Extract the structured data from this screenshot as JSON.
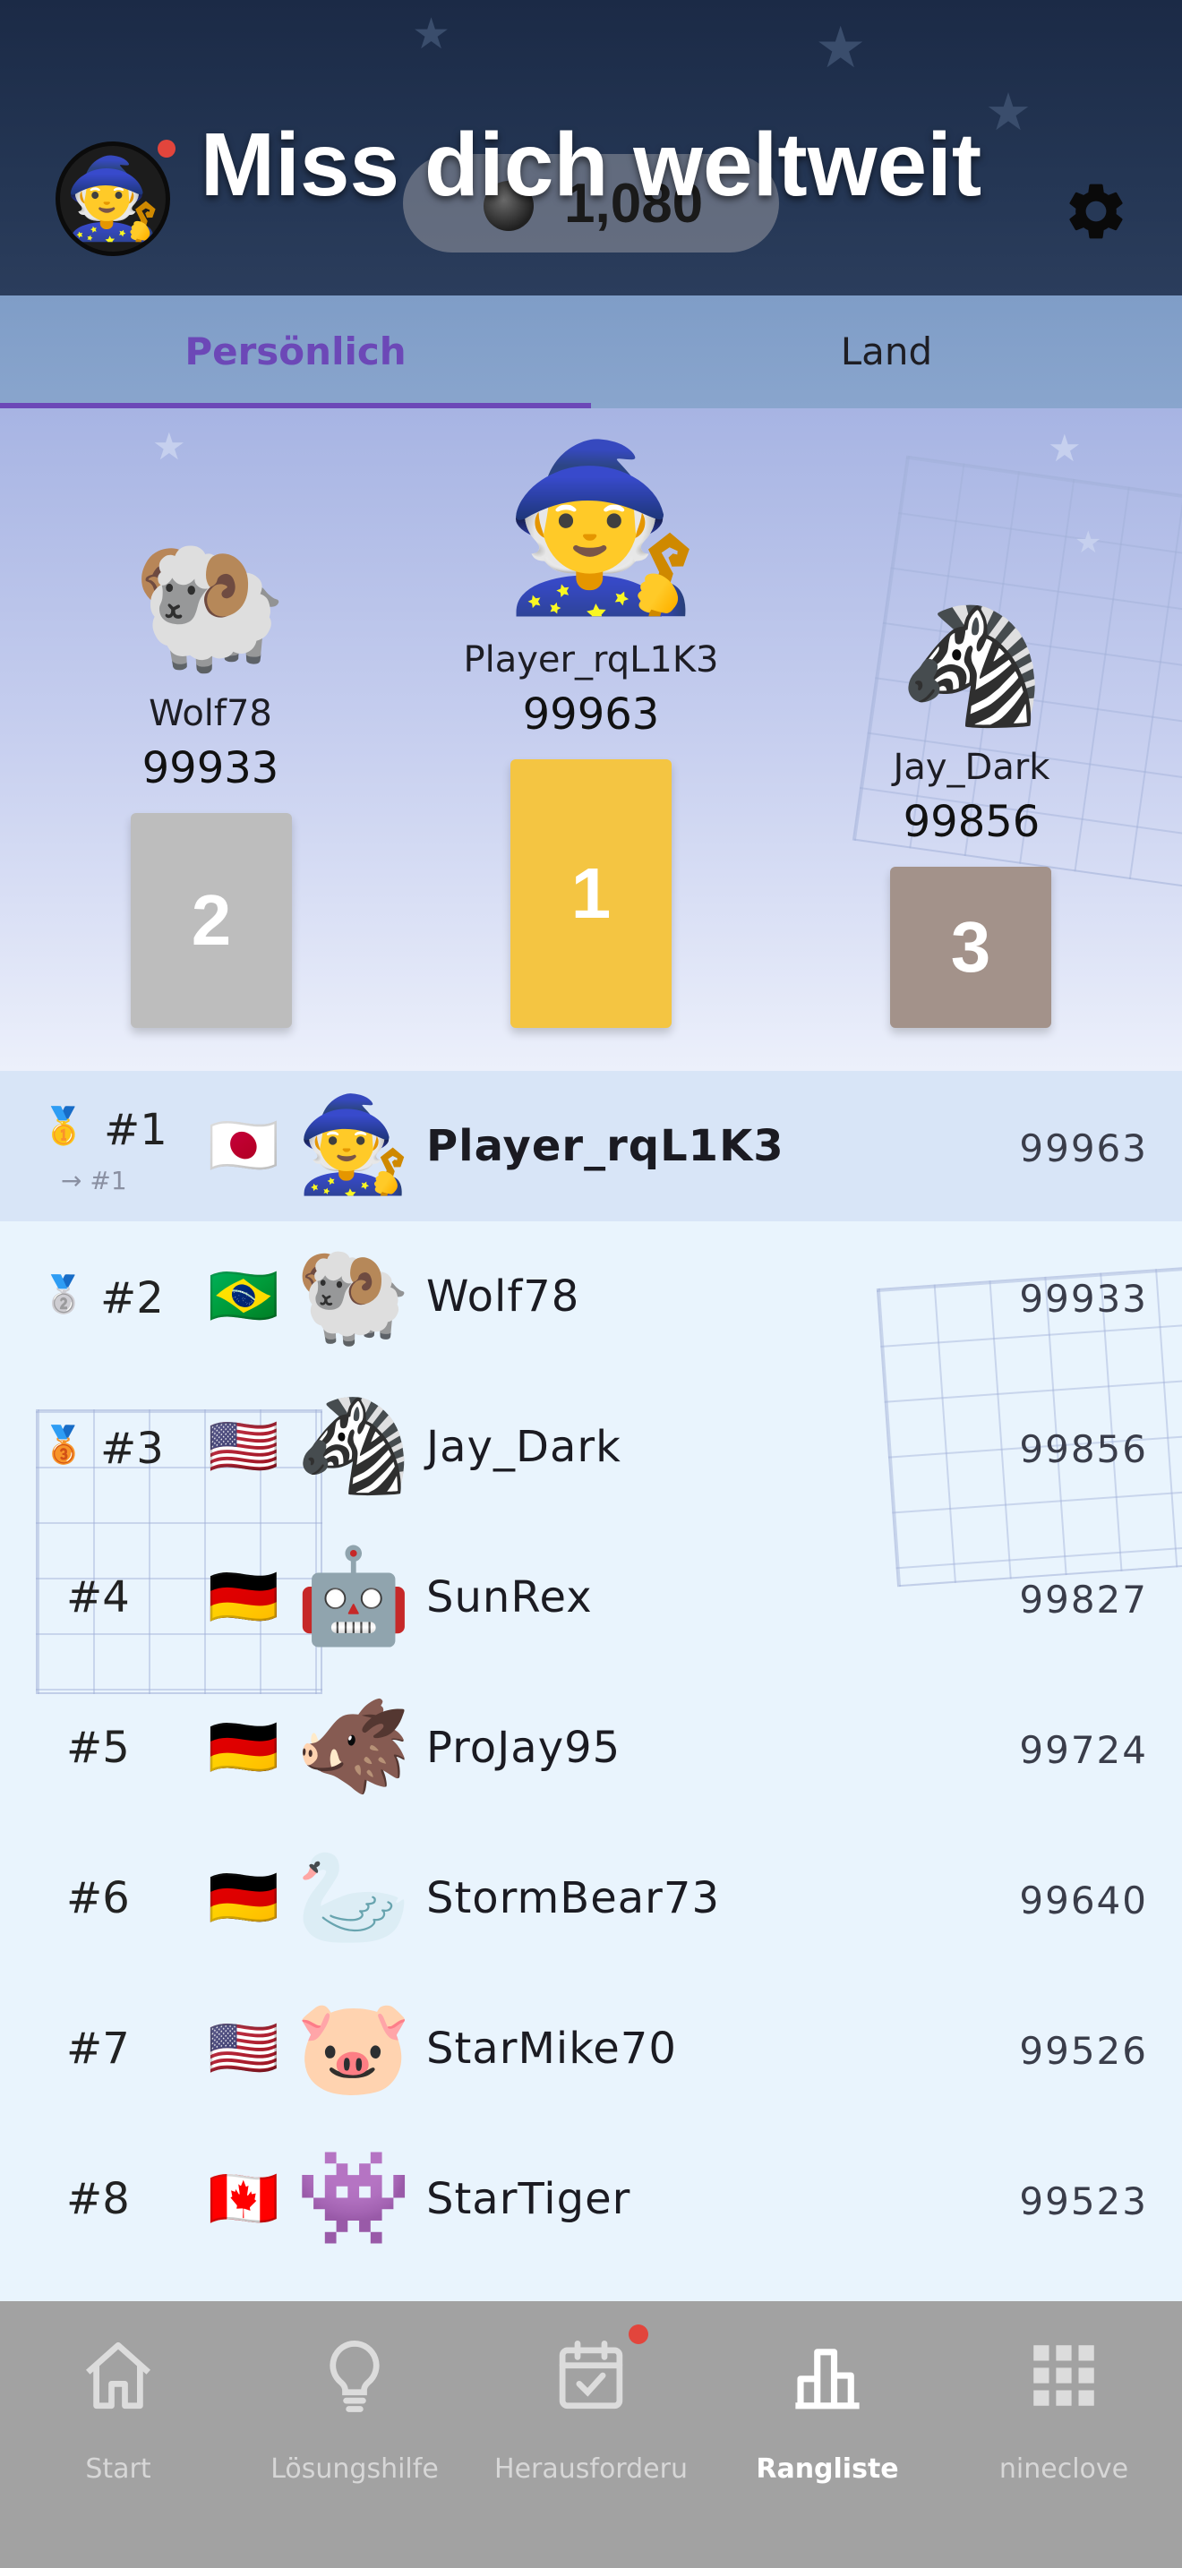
{
  "header": {
    "title": "Miss dich weltweit",
    "coins": "1,080",
    "avatar_emoji": "🧙",
    "avatar_icon": "wizard-icon",
    "settings_icon": "gear-icon"
  },
  "tabs": [
    {
      "label": "Persönlich",
      "active": true
    },
    {
      "label": "Land",
      "active": false
    }
  ],
  "podium": {
    "first": {
      "place": "1",
      "name": "Player_rqL1K3",
      "score": "99963",
      "emoji": "🧙",
      "color": "#f4c542"
    },
    "second": {
      "place": "2",
      "name": "Wolf78",
      "score": "99933",
      "emoji": "🐏",
      "color": "#bdbdbd"
    },
    "third": {
      "place": "3",
      "name": "Jay_Dark",
      "score": "99856",
      "emoji": "🦓",
      "color": "#a3928a"
    }
  },
  "leaderboard": [
    {
      "rank": "#1",
      "medal": "🥇",
      "movement": "→ #1",
      "flag": "🇯🇵",
      "emoji": "🧙",
      "name": "Player_rqL1K3",
      "score": "99963",
      "is_current_user": true
    },
    {
      "rank": "#2",
      "medal": "🥈",
      "flag": "🇧🇷",
      "emoji": "🐏",
      "name": "Wolf78",
      "score": "99933"
    },
    {
      "rank": "#3",
      "medal": "🥉",
      "flag": "🇺🇸",
      "emoji": "🦓",
      "name": "Jay_Dark",
      "score": "99856"
    },
    {
      "rank": "#4",
      "flag": "🇩🇪",
      "emoji": "🤖",
      "name": "SunRex",
      "score": "99827"
    },
    {
      "rank": "#5",
      "flag": "🇩🇪",
      "emoji": "🐗",
      "name": "ProJay95",
      "score": "99724"
    },
    {
      "rank": "#6",
      "flag": "🇩🇪",
      "emoji": "🦢",
      "name": "StormBear73",
      "score": "99640"
    },
    {
      "rank": "#7",
      "flag": "🇺🇸",
      "emoji": "🐷",
      "name": "StarMike70",
      "score": "99526"
    },
    {
      "rank": "#8",
      "flag": "🇨🇦",
      "emoji": "👾",
      "name": "StarTiger",
      "score": "99523"
    }
  ],
  "nav": [
    {
      "label": "Start",
      "icon": "home-icon"
    },
    {
      "label": "Lösungshilfe",
      "icon": "lightbulb-icon"
    },
    {
      "label": "Herausforderu",
      "icon": "calendar-check-icon",
      "badge": true
    },
    {
      "label": "Rangliste",
      "icon": "bar-chart-icon",
      "active": true
    },
    {
      "label": "nineclove",
      "icon": "grid-icon"
    }
  ],
  "colors": {
    "accent": "#6c48b7",
    "header_bg": "#1b2a46",
    "badge": "#e2453c"
  }
}
